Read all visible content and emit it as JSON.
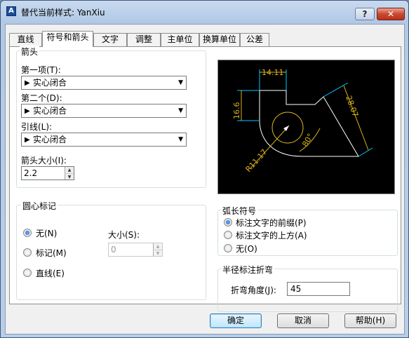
{
  "window": {
    "title": "替代当前样式: YanXiu",
    "help_label": "?",
    "close_label": "✕"
  },
  "tabs": [
    {
      "label": "直线"
    },
    {
      "label": "符号和箭头",
      "active": true
    },
    {
      "label": "文字"
    },
    {
      "label": "调整"
    },
    {
      "label": "主单位"
    },
    {
      "label": "换算单位"
    },
    {
      "label": "公差"
    }
  ],
  "arrowheads": {
    "title": "箭头",
    "first": {
      "label": "第一项(T):",
      "value": "实心闭合"
    },
    "second": {
      "label": "第二个(D):",
      "value": "实心闭合"
    },
    "leader": {
      "label": "引线(L):",
      "value": "实心闭合"
    },
    "size": {
      "label": "箭头大小(I):",
      "value": "2.2"
    }
  },
  "center_marks": {
    "title": "圆心标记",
    "options": [
      {
        "label": "无(N)",
        "selected": true
      },
      {
        "label": "标记(M)",
        "selected": false
      },
      {
        "label": "直线(E)",
        "selected": false
      }
    ],
    "size": {
      "label": "大小(S):",
      "value": "0"
    }
  },
  "preview": {
    "dim_top": "14.11",
    "dim_left": "16.6",
    "dim_right": "28.07",
    "dim_angle": "80°",
    "dim_radius": "R11.17",
    "colors": {
      "geometry": "#ffffff",
      "dimension": "#d8b11c",
      "extension": "#00c8ff",
      "background": "#000000"
    }
  },
  "arc_length": {
    "title": "弧长符号",
    "options": [
      {
        "label": "标注文字的前缀(P)",
        "selected": true
      },
      {
        "label": "标注文字的上方(A)",
        "selected": false
      },
      {
        "label": "无(O)",
        "selected": false
      }
    ]
  },
  "radius_jog": {
    "title": "半径标注折弯",
    "angle": {
      "label": "折弯角度(J):",
      "value": "45"
    }
  },
  "buttons": {
    "ok": "确定",
    "cancel": "取消",
    "help": "帮助(H)"
  }
}
